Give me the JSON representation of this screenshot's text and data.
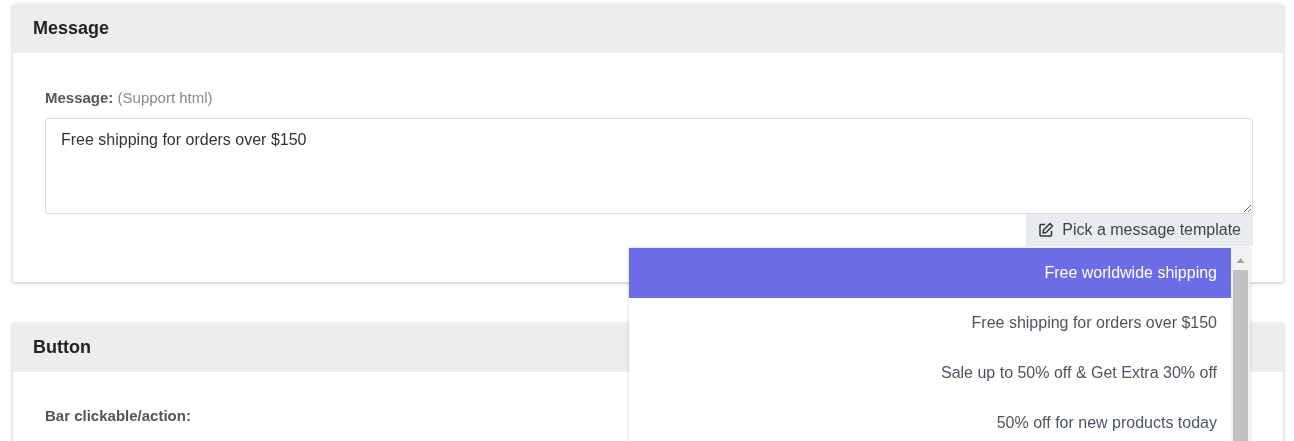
{
  "message_card": {
    "title": "Message",
    "label": "Message:",
    "label_hint": "(Support html)",
    "value": "Free shipping for orders over $150",
    "template_button": "Pick a message template"
  },
  "template_dropdown": {
    "items": [
      {
        "label": "Free worldwide shipping",
        "selected": true
      },
      {
        "label": "Free shipping for orders over $150",
        "selected": false
      },
      {
        "label": "Sale up to 50% off & Get Extra 30% off",
        "selected": false
      },
      {
        "label": "50% off for new products today",
        "selected": false
      }
    ]
  },
  "button_card": {
    "title": "Button",
    "label": "Bar clickable/action:"
  }
}
